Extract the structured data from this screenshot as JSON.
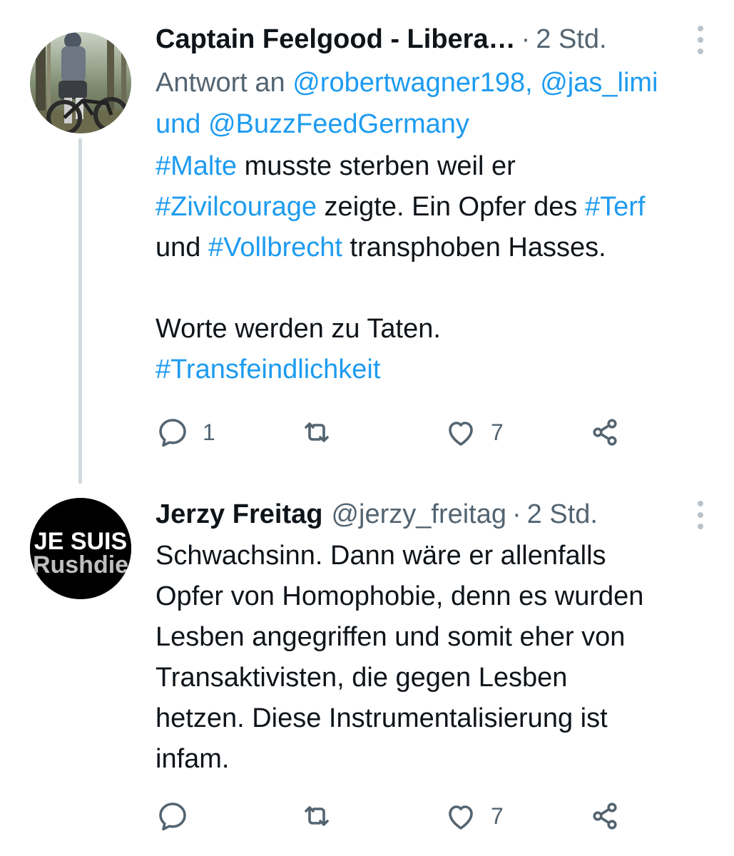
{
  "tweets": [
    {
      "name": "Captain Feelgood - Libera…",
      "handle": "",
      "separator": "·",
      "time": "2 Std.",
      "reply_to": {
        "prefix": "Antwort an",
        "handle1": "@robertwagner198,",
        "handle2": "@jas_limi",
        "conj": "und",
        "handle3": "@BuzzFeedGermany"
      },
      "body": {
        "tag_malte": "#Malte",
        "t1": " musste sterben weil er",
        "tag_zivil": "#Zivilcourage",
        "t2": " zeigte. Ein Opfer des ",
        "tag_terf": "#Terf",
        "t3": "und ",
        "tag_voll": "#Vollbrecht",
        "t4": " transphoben Hasses.",
        "line2": "Worte werden zu Taten.",
        "tag_trans": "#Transfeindlichkeit"
      },
      "actions": {
        "replies": "1",
        "retweets": "",
        "likes": "7"
      },
      "avatar_icon": "mountain-biker-photo"
    },
    {
      "name": "Jerzy Freitag",
      "handle": "@jerzy_freitag",
      "separator": "·",
      "time": "2 Std.",
      "body_lines": [
        "Schwachsinn. Dann wäre er allenfalls",
        "Opfer von Homophobie, denn es wurden",
        "Lesben angegriffen und somit eher von",
        "Transaktivisten, die gegen Lesben",
        "hetzen. Diese Instrumentalisierung ist",
        "infam."
      ],
      "actions": {
        "replies": "",
        "retweets": "",
        "likes": "7"
      },
      "avatar": {
        "line1": "JE SUIS",
        "line2": "Rushdie"
      }
    }
  ],
  "icons": [
    "reply-icon",
    "retweet-icon",
    "like-icon",
    "share-icon",
    "more-icon"
  ],
  "colors": {
    "link": "#1d9bf0",
    "secondary_text": "#536471",
    "thread_line": "#cfd9de"
  }
}
